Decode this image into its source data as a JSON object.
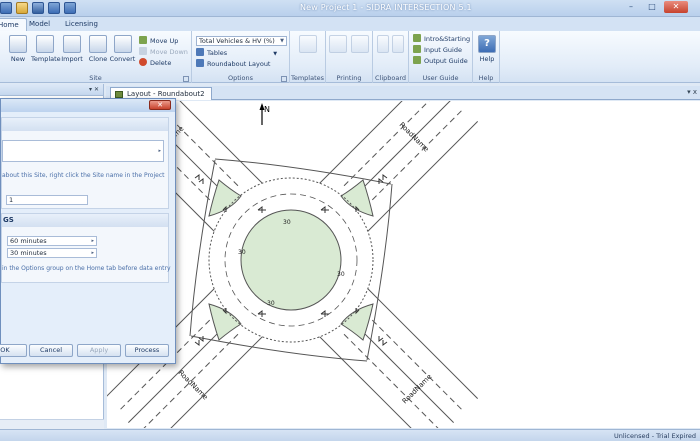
{
  "window": {
    "title": "New Project 1 - SIDRA INTERSECTION 5.1",
    "controls": {
      "minimize": "–",
      "maximize": "□",
      "close": "✕"
    }
  },
  "ribbon_tabs": [
    "Home",
    "Model",
    "Licensing"
  ],
  "ribbon": {
    "site": {
      "label": "Site",
      "new": "New",
      "template": "Template",
      "import": "Import",
      "clone": "Clone",
      "convert": "Convert",
      "move_up": "Move Up",
      "move_down": "Move Down",
      "delete": "Delete"
    },
    "options": {
      "label": "Options",
      "vehicles_select": "Total Vehicles & HV (%)",
      "tables_select": "Tables",
      "roundabout_layout": "Roundabout Layout"
    },
    "templates": {
      "label": "Templates"
    },
    "printing": {
      "label": "Printing"
    },
    "clipboard": {
      "label": "Clipboard"
    },
    "user_guide": {
      "label": "User Guide",
      "intro": "Intro&Starting",
      "input": "Input Guide",
      "output": "Output Guide"
    },
    "help": {
      "label": "Help",
      "help": "Help"
    }
  },
  "document_tab": {
    "label": "Layout - Roundabout2",
    "pin": "▾",
    "close": "x"
  },
  "canvas": {
    "north": "N",
    "road_names": [
      "RoadName",
      "RoadName",
      "RoadName",
      "RoadName"
    ],
    "lane_widths": [
      "30",
      "30",
      "30",
      "30"
    ]
  },
  "dialog": {
    "info_text": "about this Site, right click the Site name in the Project",
    "site_id_value": "1",
    "section2_header": "GS",
    "period_value": "60 minutes",
    "peak_value": "30 minutes",
    "options_hint": "in the Options group on the Home tab before data entry",
    "buttons": {
      "ok": "OK",
      "cancel": "Cancel",
      "apply": "Apply",
      "process": "Process"
    }
  },
  "status": {
    "text": "Unlicensed - Trial Expired"
  }
}
